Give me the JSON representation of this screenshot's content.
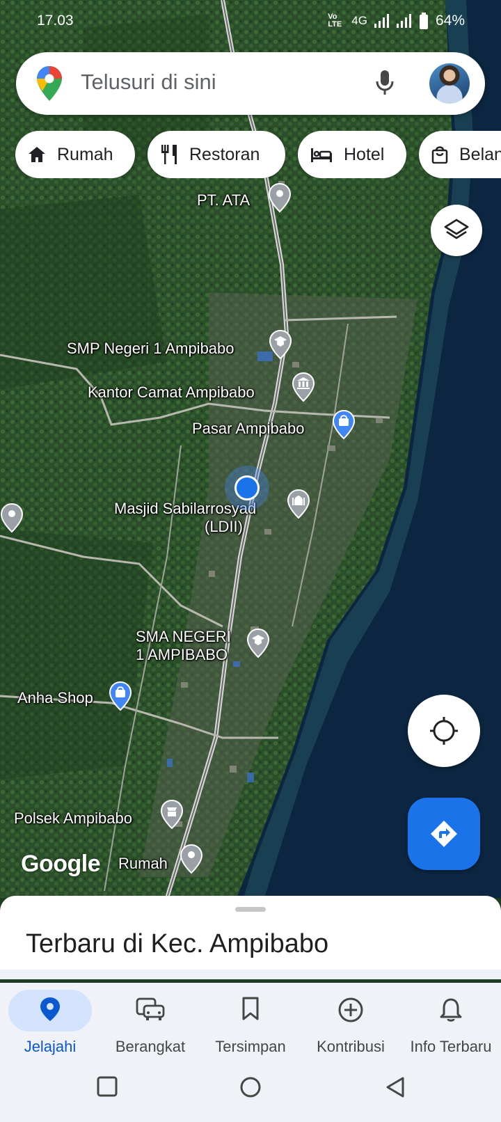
{
  "status_bar": {
    "time": "17.03",
    "network": "4G",
    "volte": "VoLTE",
    "battery": "64%"
  },
  "search": {
    "placeholder": "Telusuri di sini",
    "mic_icon": "mic-icon",
    "avatar": "profile-avatar"
  },
  "chips": [
    {
      "label": "Rumah",
      "icon": "home-icon"
    },
    {
      "label": "Restoran",
      "icon": "restaurant-icon"
    },
    {
      "label": "Hotel",
      "icon": "hotel-icon"
    },
    {
      "label": "Belanja",
      "icon": "shopping-icon"
    }
  ],
  "map": {
    "brand": "Google",
    "places": {
      "pt_ata": "PT. ATA",
      "smp": "SMP Negeri 1 Ampibabo",
      "kantor_camat": "Kantor Camat Ampibabo",
      "pasar": "Pasar Ampibabo",
      "masjid_line1": "Masjid Sabilarrosyad",
      "masjid_line2": "(LDII)",
      "sma_line1": "SMA NEGERI",
      "sma_line2": "1 AMPIBABO",
      "anha": "Anha Shop",
      "polsek": "Polsek Ampibabo",
      "rumah": "Rumah"
    }
  },
  "sheet": {
    "title": "Terbaru di Kec. Ampibabo"
  },
  "nav": [
    {
      "label": "Jelajahi",
      "active": true
    },
    {
      "label": "Berangkat",
      "active": false
    },
    {
      "label": "Tersimpan",
      "active": false
    },
    {
      "label": "Kontribusi",
      "active": false
    },
    {
      "label": "Info Terbaru",
      "active": false
    }
  ],
  "colors": {
    "accent": "#1a73e8",
    "active_pill": "#d3e3fd",
    "poi_gray": "#9aa0a6",
    "poi_blue": "#4285f4"
  }
}
